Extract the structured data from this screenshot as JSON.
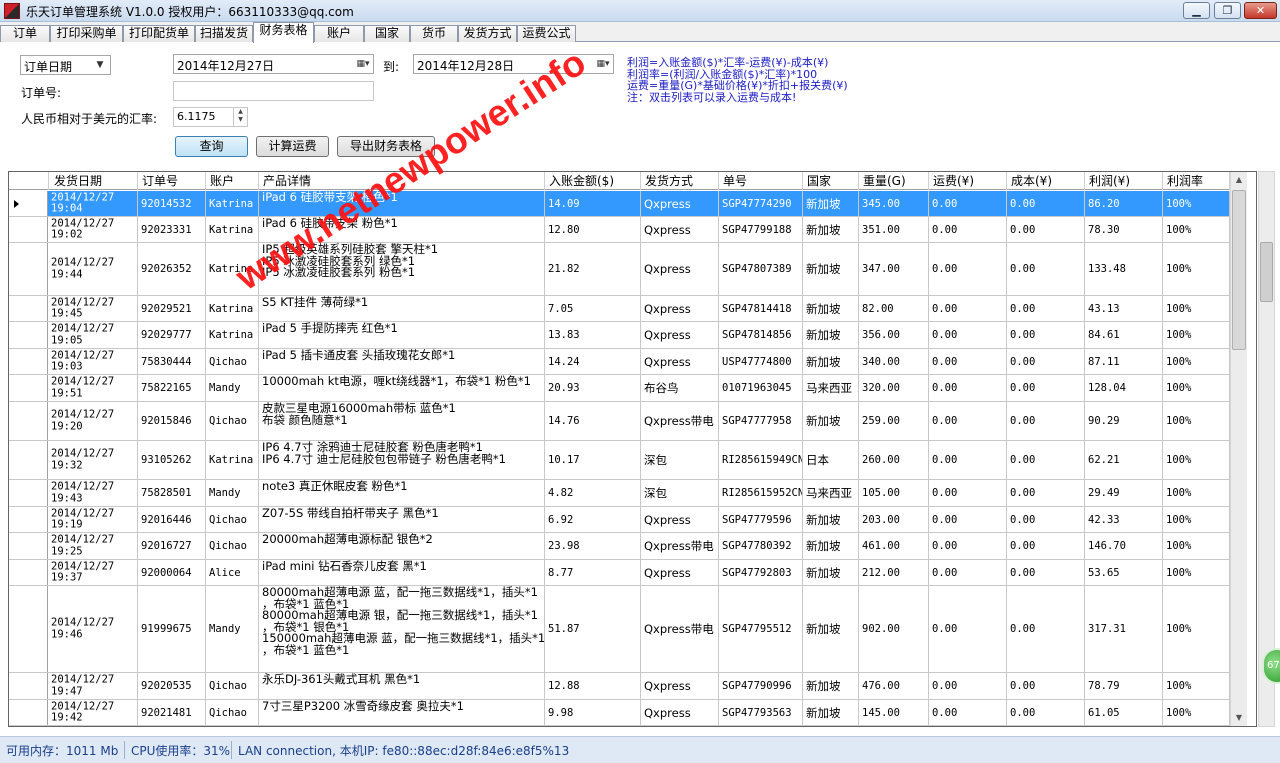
{
  "window": {
    "title": "乐天订单管理系统 V1.0.0 授权用户：663110333@qq.com",
    "min_label": "▁",
    "max_label": "❐",
    "close_label": "✕"
  },
  "tabs": [
    "订单",
    "打印采购单",
    "打印配货单",
    "扫描发货",
    "财务表格",
    "账户",
    "国家",
    "货币",
    "发货方式",
    "运费公式"
  ],
  "active_tab": "财务表格",
  "filters": {
    "date_type": "订单日期",
    "date_from": "2014年12月27日",
    "to_label": "到:",
    "date_to": "2014年12月28日",
    "order_no_label": "订单号:",
    "order_no_value": "",
    "rate_label": "人民币相对于美元的汇率:",
    "rate_value": "6.1175"
  },
  "buttons": {
    "query": "查询",
    "calc_freight": "计算运费",
    "export": "导出财务表格"
  },
  "notes": [
    "利润=入账金额($)*汇率-运费(¥)-成本(¥)",
    "利润率=(利润/入账金额($)*汇率)*100",
    "运费=重量(G)*基础价格(¥)*折扣+报关费(¥)",
    "注：双击列表可以录入运费与成本!"
  ],
  "columns": [
    "发货日期",
    "订单号",
    "账户",
    "产品详情",
    "入账金额($)",
    "发货方式",
    "单号",
    "国家",
    "重量(G)",
    "运费(¥)",
    "成本(¥)",
    "利润(¥)",
    "利润率"
  ],
  "rows": [
    {
      "date": "2014/12/27\n19:04",
      "order": "92014532",
      "account": "Katrina",
      "product": "iPad 6 硅胶带支架 橙色*1",
      "amount": "14.09",
      "ship": "Qxpress",
      "tracking": "SGP47774290",
      "country": "新加坡",
      "weight": "345.00",
      "freight": "0.00",
      "cost": "0.00",
      "profit": "86.20",
      "rate": "100%",
      "selected": true
    },
    {
      "date": "2014/12/27\n19:02",
      "order": "92023331",
      "account": "Katrina",
      "product": "iPad 6 硅胶带支架 粉色*1",
      "amount": "12.80",
      "ship": "Qxpress",
      "tracking": "SGP47799188",
      "country": "新加坡",
      "weight": "351.00",
      "freight": "0.00",
      "cost": "0.00",
      "profit": "78.30",
      "rate": "100%"
    },
    {
      "date": "2014/12/27\n19:44",
      "order": "92026352",
      "account": "Katrina",
      "product": "IP5 超级英雄系列硅胶套 擎天柱*1\nIP5 冰激凌硅胶套系列 绿色*1\nIP5 冰激凌硅胶套系列 粉色*1",
      "amount": "21.82",
      "ship": "Qxpress",
      "tracking": "SGP47807389",
      "country": "新加坡",
      "weight": "347.00",
      "freight": "0.00",
      "cost": "0.00",
      "profit": "133.48",
      "rate": "100%"
    },
    {
      "date": "2014/12/27\n19:45",
      "order": "92029521",
      "account": "Katrina",
      "product": "S5 KT挂件 薄荷绿*1",
      "amount": "7.05",
      "ship": "Qxpress",
      "tracking": "SGP47814418",
      "country": "新加坡",
      "weight": "82.00",
      "freight": "0.00",
      "cost": "0.00",
      "profit": "43.13",
      "rate": "100%"
    },
    {
      "date": "2014/12/27\n19:05",
      "order": "92029777",
      "account": "Katrina",
      "product": "iPad 5 手提防摔壳 红色*1",
      "amount": "13.83",
      "ship": "Qxpress",
      "tracking": "SGP47814856",
      "country": "新加坡",
      "weight": "356.00",
      "freight": "0.00",
      "cost": "0.00",
      "profit": "84.61",
      "rate": "100%"
    },
    {
      "date": "2014/12/27\n19:03",
      "order": "75830444",
      "account": "Qichao",
      "product": "iPad 5 插卡通皮套 头插玫瑰花女郎*1",
      "amount": "14.24",
      "ship": "Qxpress",
      "tracking": "USP47774800",
      "country": "新加坡",
      "weight": "340.00",
      "freight": "0.00",
      "cost": "0.00",
      "profit": "87.11",
      "rate": "100%"
    },
    {
      "date": "2014/12/27\n19:51",
      "order": "75822165",
      "account": "Mandy",
      "product": "10000mah kt电源，喱kt绕线器*1，布袋*1 粉色*1",
      "amount": "20.93",
      "ship": "布谷鸟",
      "tracking": "01071963045",
      "country": "马来西亚",
      "weight": "320.00",
      "freight": "0.00",
      "cost": "0.00",
      "profit": "128.04",
      "rate": "100%"
    },
    {
      "date": "2014/12/27\n19:20",
      "order": "92015846",
      "account": "Qichao",
      "product": "皮款三星电源16000mah带标 蓝色*1\n布袋 颜色随意*1",
      "amount": "14.76",
      "ship": "Qxpress带电",
      "tracking": "SGP47777958",
      "country": "新加坡",
      "weight": "259.00",
      "freight": "0.00",
      "cost": "0.00",
      "profit": "90.29",
      "rate": "100%"
    },
    {
      "date": "2014/12/27\n19:32",
      "order": "93105262",
      "account": "Katrina",
      "product": "IP6 4.7寸 涂鸦迪士尼硅胶套 粉色唐老鸭*1\nIP6 4.7寸 迪士尼硅胶包包带链子 粉色唐老鸭*1",
      "amount": "10.17",
      "ship": "深包",
      "tracking": "RI285615949CN",
      "country": "日本",
      "weight": "260.00",
      "freight": "0.00",
      "cost": "0.00",
      "profit": "62.21",
      "rate": "100%"
    },
    {
      "date": "2014/12/27\n19:43",
      "order": "75828501",
      "account": "Mandy",
      "product": "note3 真正休眠皮套 粉色*1",
      "amount": "4.82",
      "ship": "深包",
      "tracking": "RI285615952CN",
      "country": "马来西亚",
      "weight": "105.00",
      "freight": "0.00",
      "cost": "0.00",
      "profit": "29.49",
      "rate": "100%"
    },
    {
      "date": "2014/12/27\n19:19",
      "order": "92016446",
      "account": "Qichao",
      "product": "Z07-5S 带线自拍杆带夹子 黑色*1",
      "amount": "6.92",
      "ship": "Qxpress",
      "tracking": "SGP47779596",
      "country": "新加坡",
      "weight": "203.00",
      "freight": "0.00",
      "cost": "0.00",
      "profit": "42.33",
      "rate": "100%"
    },
    {
      "date": "2014/12/27\n19:25",
      "order": "92016727",
      "account": "Qichao",
      "product": "20000mah超薄电源标配 银色*2",
      "amount": "23.98",
      "ship": "Qxpress带电",
      "tracking": "SGP47780392",
      "country": "新加坡",
      "weight": "461.00",
      "freight": "0.00",
      "cost": "0.00",
      "profit": "146.70",
      "rate": "100%"
    },
    {
      "date": "2014/12/27\n19:37",
      "order": "92000064",
      "account": "Alice",
      "product": "iPad mini 钻石香奈儿皮套 黑*1",
      "amount": "8.77",
      "ship": "Qxpress",
      "tracking": "SGP47792803",
      "country": "新加坡",
      "weight": "212.00",
      "freight": "0.00",
      "cost": "0.00",
      "profit": "53.65",
      "rate": "100%"
    },
    {
      "date": "2014/12/27\n19:46",
      "order": "91999675",
      "account": "Mandy",
      "product": "80000mah超薄电源 蓝，配一拖三数据线*1，插头*1\n，布袋*1 蓝色*1\n80000mah超薄电源 银，配一拖三数据线*1，插头*1\n，布袋*1 银色*1\n150000mah超薄电源 蓝，配一拖三数据线*1，插头*1\n，布袋*1 蓝色*1",
      "amount": "51.87",
      "ship": "Qxpress带电",
      "tracking": "SGP47795512",
      "country": "新加坡",
      "weight": "902.00",
      "freight": "0.00",
      "cost": "0.00",
      "profit": "317.31",
      "rate": "100%"
    },
    {
      "date": "2014/12/27\n19:47",
      "order": "92020535",
      "account": "Qichao",
      "product": "永乐DJ-361头戴式耳机 黑色*1",
      "amount": "12.88",
      "ship": "Qxpress",
      "tracking": "SGP47790996",
      "country": "新加坡",
      "weight": "476.00",
      "freight": "0.00",
      "cost": "0.00",
      "profit": "78.79",
      "rate": "100%"
    },
    {
      "date": "2014/12/27\n19:42",
      "order": "92021481",
      "account": "Qichao",
      "product": "7寸三星P3200 冰雪奇缘皮套 奥拉夫*1",
      "amount": "9.98",
      "ship": "Qxpress",
      "tracking": "SGP47793563",
      "country": "新加坡",
      "weight": "145.00",
      "freight": "0.00",
      "cost": "0.00",
      "profit": "61.05",
      "rate": "100%"
    }
  ],
  "watermark": "www.netnewpower.info",
  "badge": "67",
  "status": {
    "memory": "可用内存：1011 Mb",
    "cpu": "CPU使用率：31%",
    "network": "LAN connection,  本机IP: fe80::88ec:d28f:84e6:e8f5%13"
  }
}
